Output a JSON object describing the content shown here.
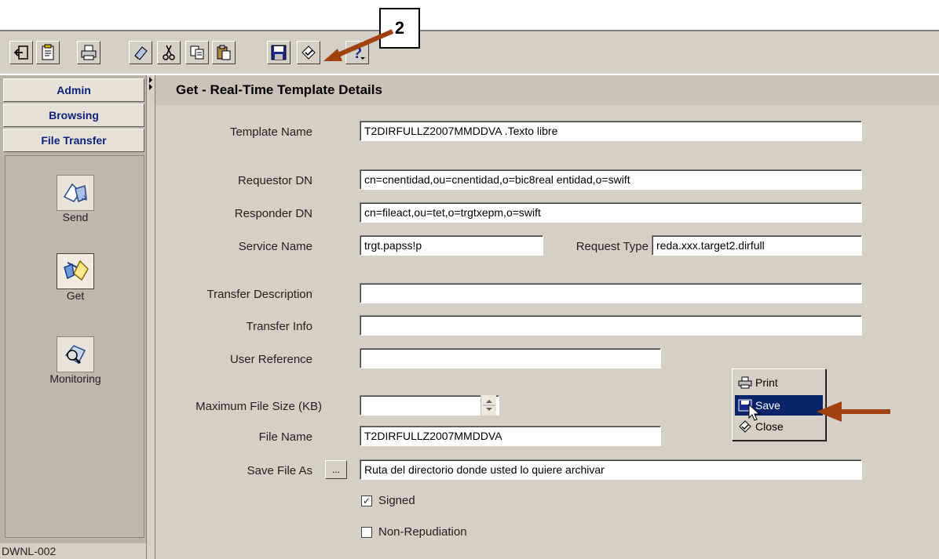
{
  "callout": "2",
  "toolbar": {
    "icons": [
      "logout-icon",
      "properties-icon",
      "print-icon",
      "eraser-icon",
      "cut-icon",
      "copy-icon",
      "paste-icon",
      "save-icon",
      "checkin-icon",
      "help-icon"
    ]
  },
  "sidebar": {
    "tabs": [
      "Admin",
      "Browsing",
      "File Transfer"
    ],
    "items": [
      {
        "label": "Send",
        "icon": "send-icon"
      },
      {
        "label": "Get",
        "icon": "get-icon"
      },
      {
        "label": "Monitoring",
        "icon": "monitoring-icon"
      }
    ],
    "status": "DWNL-002"
  },
  "main": {
    "title": "Get - Real-Time Template Details",
    "template_name_label": "Template Name",
    "template_name": "T2DIRFULLZ2007MMDDVA .Texto libre",
    "requestor_dn_label": "Requestor DN",
    "requestor_dn": "cn=cnentidad,ou=cnentidad,o=bic8real entidad,o=swift",
    "responder_dn_label": "Responder DN",
    "responder_dn": "cn=fileact,ou=tet,o=trgtxepm,o=swift",
    "service_name_label": "Service Name",
    "service_name": "trgt.papss!p",
    "request_type_label": "Request Type",
    "request_type": "reda.xxx.target2.dirfull",
    "transfer_description_label": "Transfer Description",
    "transfer_description": "",
    "transfer_info_label": "Transfer Info",
    "transfer_info": "",
    "user_reference_label": "User Reference",
    "user_reference": "",
    "max_file_size_label": "Maximum File Size (KB)",
    "max_file_size": "",
    "file_name_label": "File Name",
    "file_name": "T2DIRFULLZ2007MMDDVA",
    "save_file_as_label": "Save File As",
    "browse_label": "...",
    "save_file_as": "Ruta del directorio donde usted lo quiere archivar",
    "signed_label": "Signed",
    "signed_mark": "✓",
    "non_repudiation_label": "Non-Repudiation"
  },
  "popup": {
    "print": "Print",
    "save": "Save",
    "close": "Close"
  },
  "colors": {
    "arrow": "#a0420e",
    "menu_highlight": "#0a246a",
    "sidebar_label": "#10217a"
  }
}
